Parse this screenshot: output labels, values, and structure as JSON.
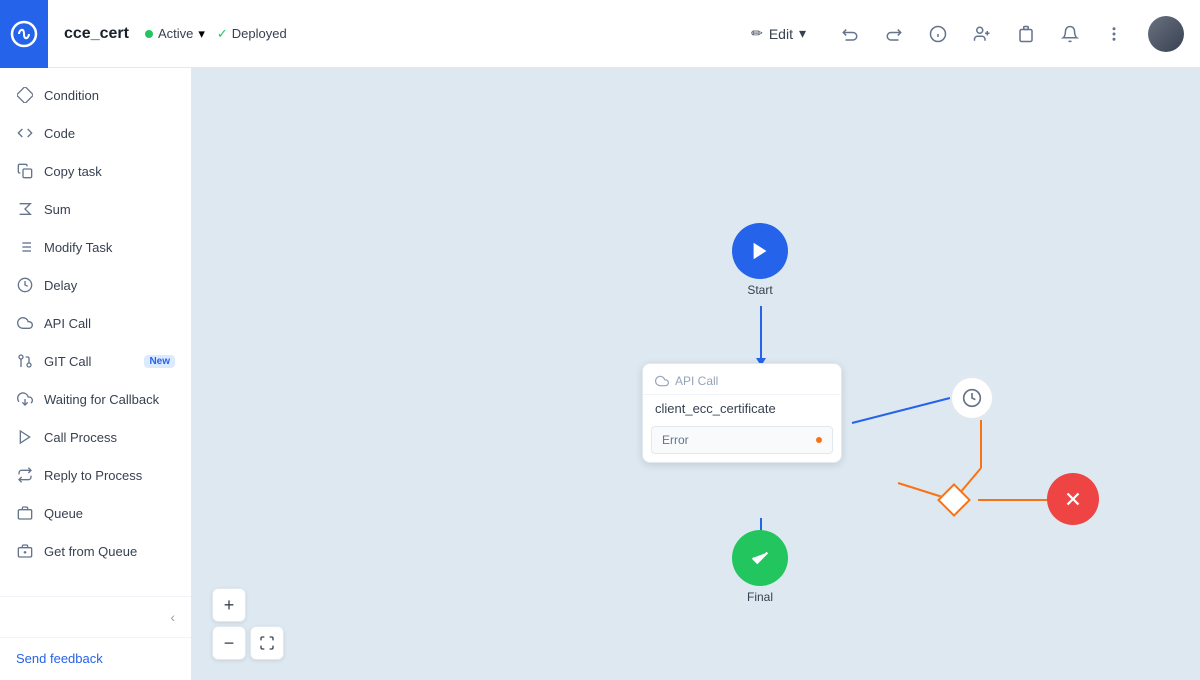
{
  "header": {
    "logo_alt": "Logo",
    "app_title": "cce_cert",
    "status_active": "Active",
    "status_deployed": "Deployed",
    "edit_label": "Edit",
    "edit_icon": "✏️"
  },
  "header_actions": {
    "undo": "↩",
    "redo": "↪",
    "info": "ℹ",
    "add_user": "👤+",
    "clipboard": "📋",
    "bell": "🔔",
    "more": "⋮"
  },
  "sidebar": {
    "items": [
      {
        "id": "condition",
        "label": "Condition",
        "icon": "◇"
      },
      {
        "id": "code",
        "label": "Code",
        "icon": "<>"
      },
      {
        "id": "copy-task",
        "label": "Copy task",
        "icon": "⧉"
      },
      {
        "id": "sum",
        "label": "Sum",
        "icon": "Σ"
      },
      {
        "id": "modify-task",
        "label": "Modify Task",
        "icon": "☰"
      },
      {
        "id": "delay",
        "label": "Delay",
        "icon": "⏱"
      },
      {
        "id": "api-call",
        "label": "API Call",
        "icon": "☁"
      },
      {
        "id": "git-call",
        "label": "GIT Call",
        "icon": "⑂",
        "badge": "New"
      },
      {
        "id": "waiting-callback",
        "label": "Waiting for Callback",
        "icon": "⬇"
      },
      {
        "id": "call-process",
        "label": "Call Process",
        "icon": "▶"
      },
      {
        "id": "reply-process",
        "label": "Reply to Process",
        "icon": "↔"
      },
      {
        "id": "queue",
        "label": "Queue",
        "icon": "▤"
      },
      {
        "id": "get-queue",
        "label": "Get from Queue",
        "icon": "⊡"
      }
    ],
    "footer": {
      "send_feedback": "Send feedback"
    }
  },
  "canvas": {
    "nodes": {
      "start": {
        "label": "Start"
      },
      "api_call": {
        "type_label": "API Call",
        "title": "client_ecc_certificate",
        "error_label": "Error"
      },
      "final": {
        "label": "Final"
      }
    }
  },
  "zoom": {
    "plus": "+",
    "minus": "−",
    "fit": "⤡"
  }
}
